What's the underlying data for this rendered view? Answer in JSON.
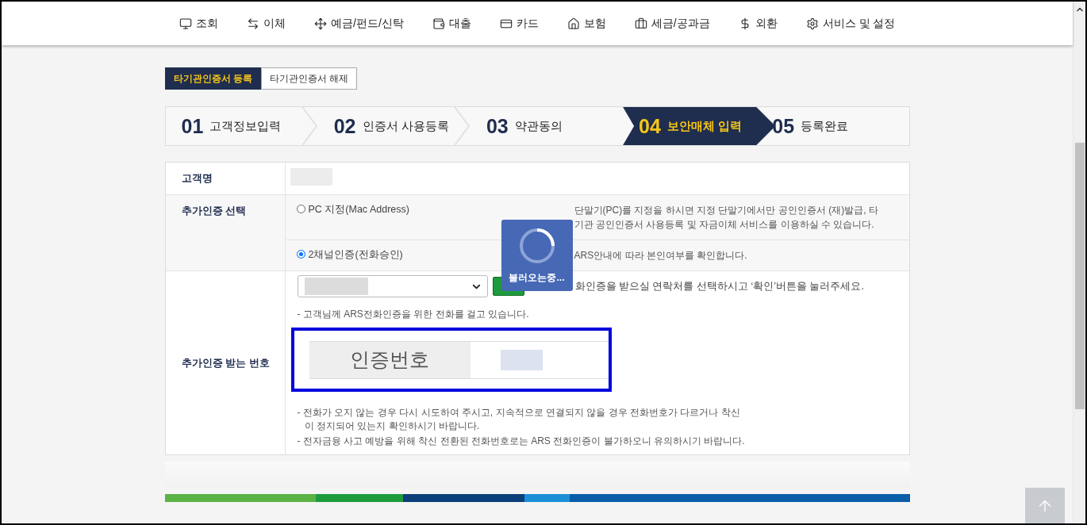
{
  "nav": [
    {
      "label": "조회",
      "kind": "monitor"
    },
    {
      "label": "이체",
      "kind": "transfer"
    },
    {
      "label": "예금/펀드/신탁",
      "kind": "move"
    },
    {
      "label": "대출",
      "kind": "wallet"
    },
    {
      "label": "카드",
      "kind": "card"
    },
    {
      "label": "보험",
      "kind": "home"
    },
    {
      "label": "세금/공과금",
      "kind": "briefcase"
    },
    {
      "label": "외환",
      "kind": "dollar"
    },
    {
      "label": "서비스 및 설정",
      "kind": "settings"
    }
  ],
  "tabs": [
    {
      "label": "타기관인증서 등록",
      "selected": true
    },
    {
      "label": "타기관인증서 해제",
      "selected": false
    }
  ],
  "steps": [
    {
      "number": "01",
      "label": "고객정보입력",
      "selected": false
    },
    {
      "number": "02",
      "label": "인증서 사용등록",
      "selected": false
    },
    {
      "number": "03",
      "label": "약관동의",
      "selected": false
    },
    {
      "number": "04",
      "label": "보안매체 입력",
      "selected": true
    },
    {
      "number": "05",
      "label": "등록완료",
      "selected": false
    }
  ],
  "form": {
    "customer": {
      "label": "고객명"
    },
    "auth_select": {
      "label": "추가인증 선택",
      "options": [
        {
          "label": "PC 지정(Mac Address)",
          "selected": false,
          "description": "단말기(PC)를 지정을 하시면 지정 단말기에서만 공인인증서 (재)발급, 타기관 공인인증서 사용등록 및 자금이체 서비스를 이용하실 수 있습니다."
        },
        {
          "label": "2채널인증(전화승인)",
          "selected": true,
          "description": "ARS안내에 따라 본인여부를 확인합니다."
        }
      ]
    },
    "auth_number": {
      "label": "추가인증 받는 번호",
      "hint": "화인증을 받으실 연락처를 선택하시고 ‘확인’버튼을 눌러주세요.",
      "notes_top": [
        "- 고객님께 ARS전화인증을 위한 전화를 걸고 있습니다."
      ],
      "code_label": "인증번호",
      "notes_bottom": [
        "- 전화가 오지 않는 경우 다시 시도하여 주시고, 지속적으로 연결되지 않을 경우 전화번호가 다르거나 착신이 정지되어 있는지 확인하시기 바랍니다.",
        "- 전자금융 사고 예방을 위해 착신 전환된 전화번호로는 ARS 전화인증이 불가하오니 유의하시기 바랍니다."
      ]
    }
  },
  "loading": {
    "text": "불러오는중..."
  }
}
